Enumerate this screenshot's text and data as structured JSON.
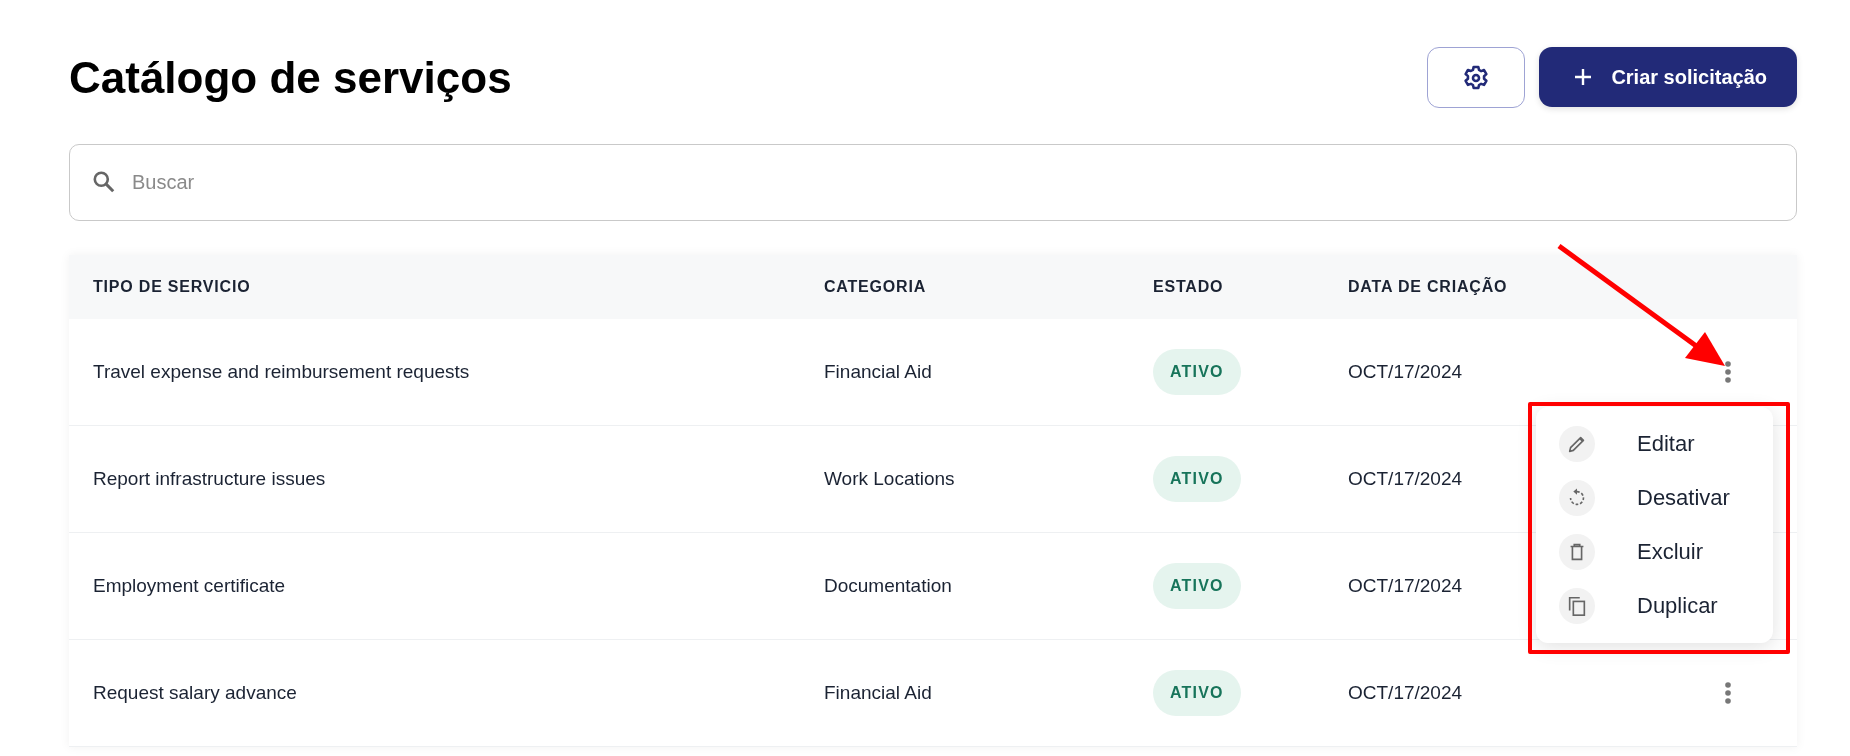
{
  "page": {
    "title": "Catálogo de serviços"
  },
  "header_actions": {
    "create_button": {
      "label": "Criar solicitação"
    }
  },
  "search": {
    "placeholder": "Buscar"
  },
  "table": {
    "columns": [
      "TIPO DE SERVICIO",
      "CATEGORIA",
      "ESTADO",
      "DATA DE CRIAÇÃO"
    ],
    "rows": [
      {
        "service": "Travel expense and reimbursement requests",
        "category": "Financial Aid",
        "status": {
          "label": "ATIVO",
          "kind": "active"
        },
        "created": "OCT/17/2024",
        "actions_visible": true
      },
      {
        "service": "Report infrastructure issues",
        "category": "Work Locations",
        "status": {
          "label": "ATIVO",
          "kind": "active"
        },
        "created": "OCT/17/2024",
        "actions_visible": false
      },
      {
        "service": "Employment certificate",
        "category": "Documentation",
        "status": {
          "label": "ATIVO",
          "kind": "active"
        },
        "created": "OCT/17/2024",
        "actions_visible": false
      },
      {
        "service": "Request salary advance",
        "category": "Financial Aid",
        "status": {
          "label": "ATIVO",
          "kind": "active"
        },
        "created": "OCT/17/2024",
        "actions_visible": true
      }
    ]
  },
  "actions_menu": {
    "items": [
      {
        "label": "Editar",
        "kind": "edit"
      },
      {
        "label": "Desativar",
        "kind": "deactivate"
      },
      {
        "label": "Excluir",
        "kind": "delete"
      },
      {
        "label": "Duplicar",
        "kind": "duplicate"
      }
    ]
  }
}
